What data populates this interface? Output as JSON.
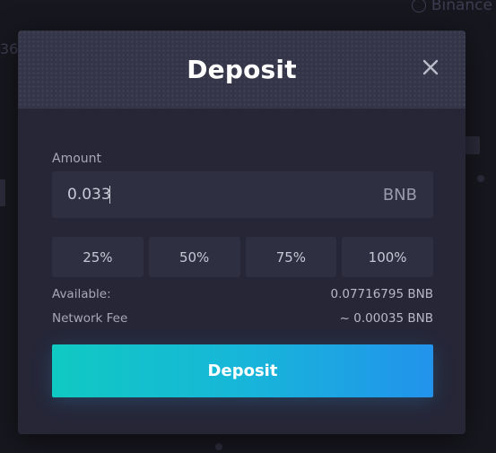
{
  "background": {
    "token_name": "Binance",
    "partial_number": "36"
  },
  "modal": {
    "title": "Deposit",
    "close_icon": "close-icon",
    "amount": {
      "label": "Amount",
      "value": "0.033",
      "currency": "BNB"
    },
    "percent_options": [
      "25%",
      "50%",
      "75%",
      "100%"
    ],
    "available": {
      "label": "Available:",
      "value": "0.07716795 BNB"
    },
    "network_fee": {
      "label": "Network Fee",
      "value": "~ 0.00035 BNB"
    },
    "submit_label": "Deposit"
  },
  "colors": {
    "modal_bg": "#262637",
    "header_bg": "#353549",
    "input_bg": "#2f2f42",
    "button_gradient_start": "#10c9c2",
    "button_gradient_end": "#2293ec"
  }
}
